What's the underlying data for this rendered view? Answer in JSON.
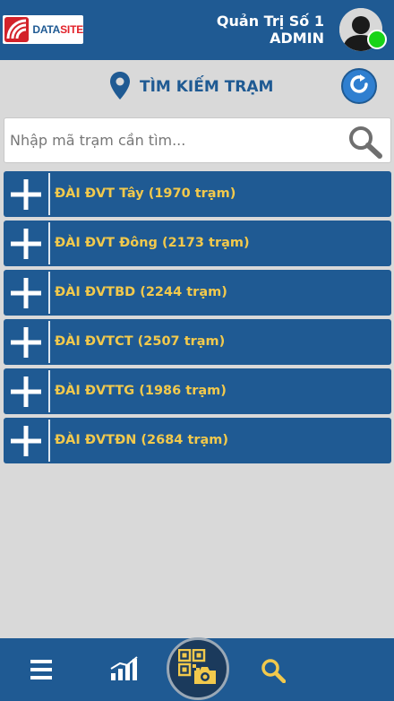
{
  "header": {
    "logo_prefix": "DATA",
    "logo_suffix": "SITE",
    "user_name": "Quản Trị Số 1",
    "user_role": "ADMIN"
  },
  "title": {
    "text": "TÌM KIẾM TRẠM"
  },
  "search": {
    "placeholder": "Nhập mã trạm cần tìm...",
    "value": ""
  },
  "stations": [
    {
      "label": "ĐÀI ĐVT Tây (1970 trạm)"
    },
    {
      "label": "ĐÀI ĐVT Đông (2173 trạm)"
    },
    {
      "label": "ĐÀI ĐVTBD (2244 trạm)"
    },
    {
      "label": "ĐÀI ĐVTCT (2507 trạm)"
    },
    {
      "label": "ĐÀI ĐVTTG (1986 trạm)"
    },
    {
      "label": "ĐÀI ĐVTĐN (2684 trạm)"
    }
  ],
  "icons": {
    "logo": "datasite-logo-icon",
    "avatar": "user-avatar-icon",
    "status": "online-status-icon",
    "title": "location-pin-icon",
    "refresh": "refresh-icon",
    "search": "search-icon",
    "expand": "plus-icon",
    "nav_menu": "menu-icon",
    "nav_stats": "bar-chart-icon",
    "nav_scan": "qr-camera-icon",
    "nav_search": "search-icon"
  },
  "colors": {
    "primary": "#1f5a93",
    "accent": "#f2c94c",
    "background": "#d9d9d9",
    "online": "#19d418",
    "refresh": "#2f7fd0"
  }
}
